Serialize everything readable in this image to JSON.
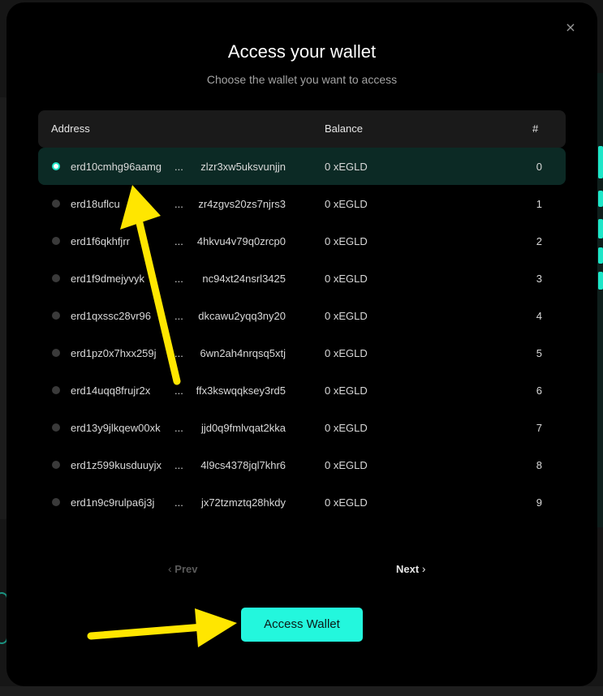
{
  "modal": {
    "title": "Access your wallet",
    "subtitle": "Choose the wallet you want to access",
    "close_symbol": "×"
  },
  "table": {
    "headers": {
      "address": "Address",
      "balance": "Balance",
      "index": "#"
    },
    "separator": "...",
    "rows": [
      {
        "addr_start": "erd10cmhg96aamg",
        "addr_end": "zlzr3xw5uksvunjjn",
        "balance": "0 xEGLD",
        "index": "0",
        "selected": true
      },
      {
        "addr_start": "erd18uflcu",
        "addr_end": "zr4zgvs20zs7njrs3",
        "balance": "0 xEGLD",
        "index": "1",
        "selected": false
      },
      {
        "addr_start": "erd1f6qkhfjrr",
        "addr_end": "4hkvu4v79q0zrcp0",
        "balance": "0 xEGLD",
        "index": "2",
        "selected": false
      },
      {
        "addr_start": "erd1f9dmejyvyk",
        "addr_end": "nc94xt24nsrl3425",
        "balance": "0 xEGLD",
        "index": "3",
        "selected": false
      },
      {
        "addr_start": "erd1qxssc28vr96",
        "addr_end": "dkcawu2yqq3ny20",
        "balance": "0 xEGLD",
        "index": "4",
        "selected": false
      },
      {
        "addr_start": "erd1pz0x7hxx259j",
        "addr_end": "6wn2ah4nrqsq5xtj",
        "balance": "0 xEGLD",
        "index": "5",
        "selected": false
      },
      {
        "addr_start": "erd14uqq8frujr2x",
        "addr_end": "ffx3kswqqksey3rd5",
        "balance": "0 xEGLD",
        "index": "6",
        "selected": false
      },
      {
        "addr_start": "erd13y9jlkqew00xk",
        "addr_end": "jjd0q9fmlvqat2kka",
        "balance": "0 xEGLD",
        "index": "7",
        "selected": false
      },
      {
        "addr_start": "erd1z599kusduuyjx",
        "addr_end": "4l9cs4378jql7khr6",
        "balance": "0 xEGLD",
        "index": "8",
        "selected": false
      },
      {
        "addr_start": "erd1n9c9rulpa6j3j",
        "addr_end": "jx72tzmztq28hkdy",
        "balance": "0 xEGLD",
        "index": "9",
        "selected": false
      }
    ]
  },
  "pager": {
    "prev_label": "Prev",
    "next_label": "Next",
    "prev_icon": "chevron-left-icon",
    "next_icon": "chevron-right-icon"
  },
  "actions": {
    "access_label": "Access Wallet"
  },
  "colors": {
    "accent": "#23f7dd",
    "selected_row": "#0c2a25",
    "annotation_arrow": "#ffe600"
  }
}
